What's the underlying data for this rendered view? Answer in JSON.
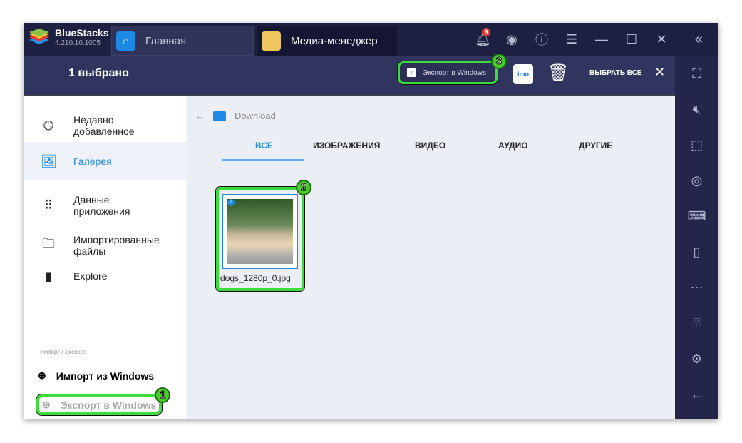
{
  "app": {
    "brand": "BlueStacks",
    "version": "4.210.10.1005"
  },
  "tabs": [
    {
      "label": "Главная"
    },
    {
      "label": "Медиа-менеджер"
    }
  ],
  "titlebar": {
    "notification_count": "9"
  },
  "header": {
    "selected": "1 выбрано",
    "export_label": "Экспорт в Windows",
    "imo": "imo",
    "select_all": "ВЫБРАТЬ ВСЕ"
  },
  "sidebar": {
    "items": [
      {
        "label": "Недавно добавленное"
      },
      {
        "label": "Галерея"
      },
      {
        "label": "Данные приложения"
      },
      {
        "label": "Импортированные файлы"
      },
      {
        "label": "Explore"
      }
    ],
    "section_label": "Импорт / Экспорт",
    "import": "Импорт из Windows",
    "export": "Экспорт в Windows"
  },
  "content": {
    "folder": "Download",
    "filters": [
      "ВСЕ",
      "ИЗОБРАЖЕНИЯ",
      "ВИДЕО",
      "АУДИО",
      "ДРУГИЕ"
    ],
    "active_filter": "ВСЕ",
    "files": [
      {
        "name": "dogs_1280p_0.jpg",
        "selected": true
      }
    ]
  },
  "annotations": [
    "1",
    "2",
    "3"
  ],
  "colors": {
    "accent": "#1e88e5",
    "highlight": "#3ddc3d"
  }
}
